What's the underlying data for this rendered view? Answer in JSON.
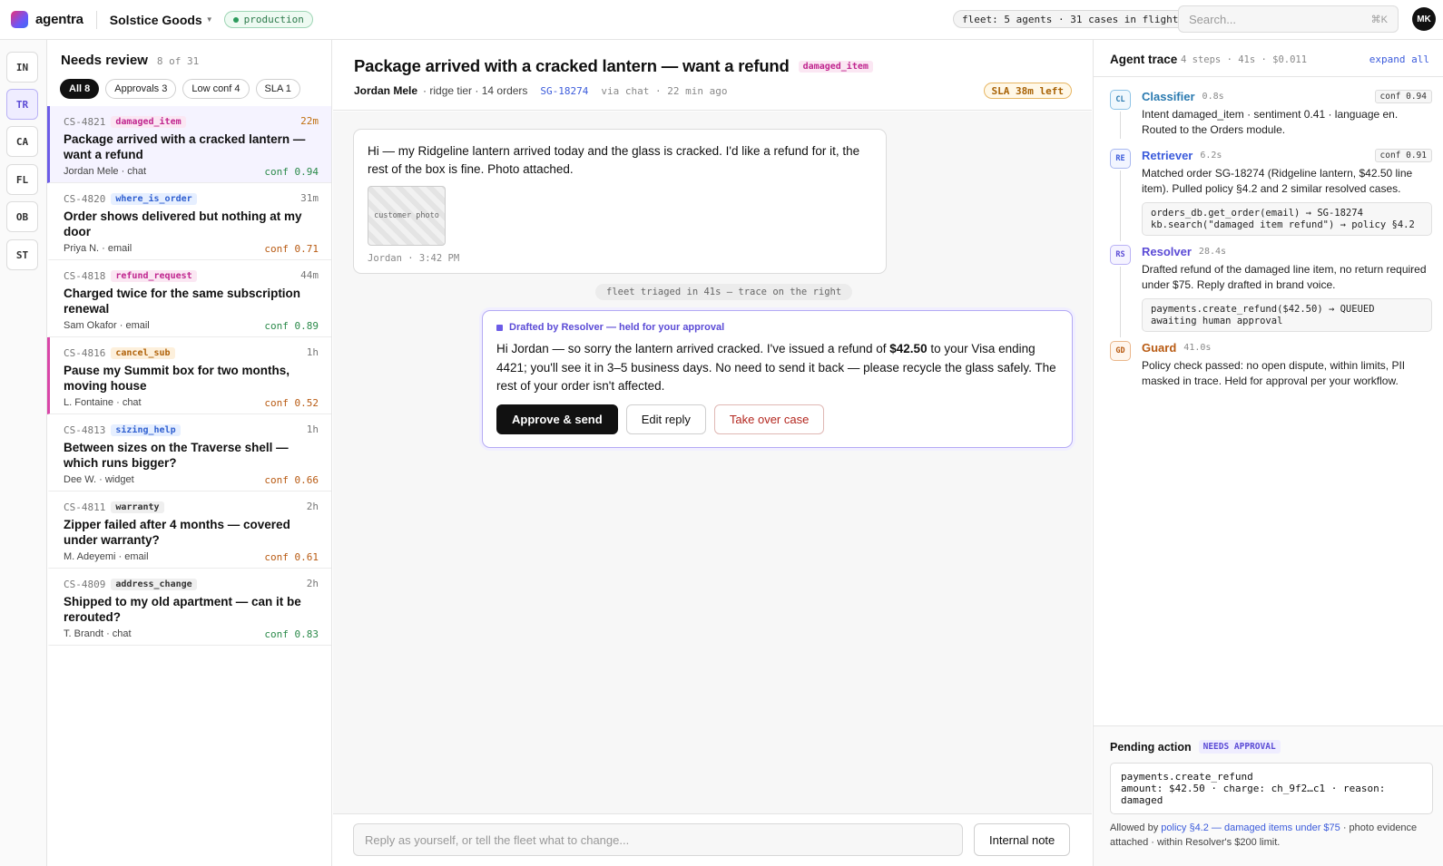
{
  "topbar": {
    "app_name": "agentra",
    "workspace": "Solstice Goods",
    "environment": "production",
    "fleet_status": "fleet: 5 agents · 31 cases in flight",
    "search_placeholder": "Search...",
    "search_shortcut": "⌘K",
    "user_initials": "MK"
  },
  "rail": [
    "IN",
    "TR",
    "CA",
    "FL",
    "OB",
    "ST"
  ],
  "rail_active": "TR",
  "list": {
    "title": "Needs review",
    "count": "8 of 31",
    "filters": [
      "All 8",
      "Approvals 3",
      "Low conf 4",
      "SLA 1"
    ],
    "cases": [
      {
        "id": "CS-4821",
        "tag": "damaged_item",
        "time": "22m",
        "title": "Package arrived with a cracked lantern — want a refund",
        "meta": "Jordan Mele · chat",
        "conf": "conf 0.94"
      },
      {
        "id": "CS-4820",
        "tag": "where_is_order",
        "time": "31m",
        "title": "Order shows delivered but nothing at my door",
        "meta": "Priya N. · email",
        "conf": "conf 0.71"
      },
      {
        "id": "CS-4818",
        "tag": "refund_request",
        "time": "44m",
        "title": "Charged twice for the same subscription renewal",
        "meta": "Sam Okafor · email",
        "conf": "conf 0.89"
      },
      {
        "id": "CS-4816",
        "tag": "cancel_sub",
        "time": "1h",
        "title": "Pause my Summit box for two months, moving house",
        "meta": "L. Fontaine · chat",
        "conf": "conf 0.52"
      },
      {
        "id": "CS-4813",
        "tag": "sizing_help",
        "time": "1h",
        "title": "Between sizes on the Traverse shell — which runs bigger?",
        "meta": "Dee W. · widget",
        "conf": "conf 0.66"
      },
      {
        "id": "CS-4811",
        "tag": "warranty",
        "time": "2h",
        "title": "Zipper failed after 4 months — covered under warranty?",
        "meta": "M. Adeyemi · email",
        "conf": "conf 0.61"
      },
      {
        "id": "CS-4809",
        "tag": "address_change",
        "time": "2h",
        "title": "Shipped to my old apartment — can it be rerouted?",
        "meta": "T. Brandt · chat",
        "conf": "conf 0.83"
      }
    ]
  },
  "case": {
    "title": "Package arrived with a cracked lantern — want a refund",
    "tag": "damaged_item",
    "customer": "Jordan Mele",
    "customer_detail": "· ridge tier · 14 orders",
    "order": "SG-18274",
    "via": "via chat · 22 min ago",
    "sla": "SLA 38m left",
    "message": "Hi — my Ridgeline lantern arrived today and the glass is cracked. I'd like a refund for it, the rest of the box is fine. Photo attached.",
    "photo_label": "customer photo",
    "message_footer": "Jordan · 3:42 PM",
    "system_note": "fleet triaged in 41s — trace on the right",
    "draft_label": "Drafted by Resolver — held for your approval",
    "draft_pre": "Hi Jordan — so sorry the lantern arrived cracked. I've issued a refund of ",
    "draft_amount": "$42.50",
    "draft_post": " to your Visa ending 4421; you'll see it in 3–5 business days. No need to send it back — please recycle the glass safely. The rest of your order isn't affected.",
    "approve_label": "Approve & send",
    "edit_label": "Edit reply",
    "takeover_label": "Take over case",
    "compose_placeholder": "Reply as yourself, or tell the fleet what to change...",
    "internal_note_label": "Internal note"
  },
  "trace": {
    "title": "Agent trace",
    "summary": "4 steps · 41s · $0.011",
    "expand_label": "expand all",
    "steps": [
      {
        "badge": "CL",
        "name": "Classifier",
        "time": "0.8s",
        "conf": "conf 0.94",
        "desc": "Intent damaged_item · sentiment 0.41 · language en. Routed to the Orders module.",
        "code": ""
      },
      {
        "badge": "RE",
        "name": "Retriever",
        "time": "6.2s",
        "conf": "conf 0.91",
        "desc": "Matched order SG-18274 (Ridgeline lantern, $42.50 line item). Pulled policy §4.2 and 2 similar resolved cases.",
        "code": "orders_db.get_order(email) → SG-18274\nkb.search(\"damaged item refund\") → policy §4.2"
      },
      {
        "badge": "RS",
        "name": "Resolver",
        "time": "28.4s",
        "conf": "",
        "desc": "Drafted refund of the damaged line item, no return required under $75. Reply drafted in brand voice.",
        "code": "payments.create_refund($42.50) → QUEUED\nawaiting human approval"
      },
      {
        "badge": "GD",
        "name": "Guard",
        "time": "41.0s",
        "conf": "",
        "desc": "Policy check passed: no open dispute, within limits, PII masked in trace. Held for approval per your workflow.",
        "code": ""
      }
    ]
  },
  "pending": {
    "title": "Pending action",
    "badge": "NEEDS APPROVAL",
    "code_line1": "payments.create_refund",
    "code_line2": "amount: $42.50 · charge: ch_9f2…c1 · reason: damaged",
    "note_pre": "Allowed by ",
    "note_link": "policy §4.2 — damaged items under $75",
    "note_post": " · photo evidence attached · within Resolver's $200 limit."
  },
  "colors": {
    "accent": "#6c5ce7",
    "tag_pink": "#c0268f",
    "tag_blue": "#2f5fd0",
    "tag_amber": "#b0620a",
    "conf_green": "#2b8a4a",
    "conf_amber": "#b85a12"
  }
}
